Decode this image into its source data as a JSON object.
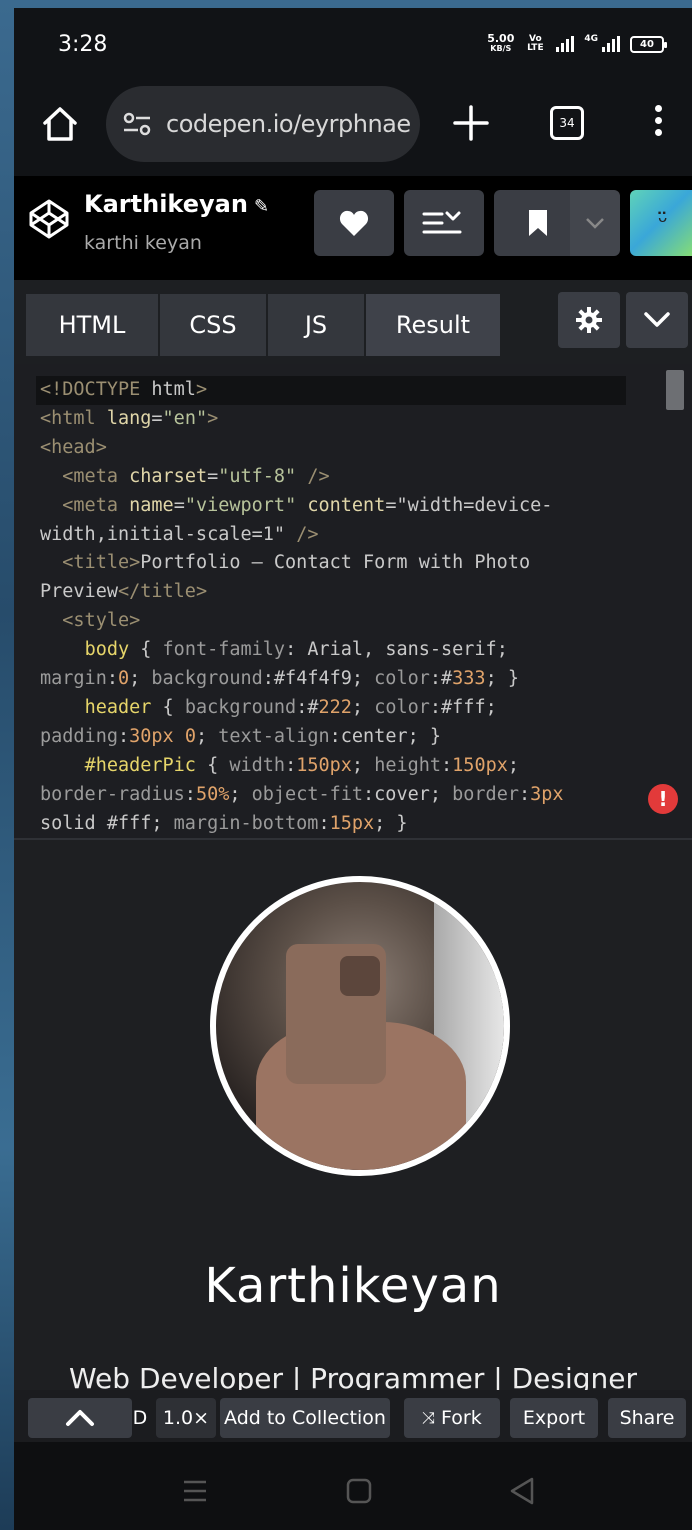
{
  "status": {
    "time": "3:28",
    "net_speed_top": "5.00",
    "net_speed_bottom": "KB/S",
    "network_label": "Vo LTE",
    "network2": "4G",
    "battery": "40"
  },
  "browser": {
    "url": "codepen.io/eyrphnae",
    "tab_count": "34"
  },
  "pen": {
    "author": "Karthikeyan",
    "username": "karthi keyan"
  },
  "tabs": [
    "HTML",
    "CSS",
    "JS",
    "Result"
  ],
  "code_lines": [
    "<!DOCTYPE html>",
    "<html lang=\"en\">",
    "<head>",
    "  <meta charset=\"utf-8\" />",
    "  <meta name=\"viewport\" content=\"width=device-",
    "width,initial-scale=1\" />",
    "  <title>Portfolio – Contact Form with Photo",
    "Preview</title>",
    "  <style>",
    "    body { font-family: Arial, sans-serif;",
    "margin:0; background:#f4f4f9; color:#333; }",
    "    header { background:#222; color:#fff;",
    "padding:30px 0; text-align:center; }",
    "    #headerPic { width:150px; height:150px;",
    "border-radius:50%; object-fit:cover; border:3px",
    "solid #fff; margin-bottom:15px; }"
  ],
  "preview": {
    "name": "Karthikeyan",
    "role": "Web Developer | Programmer | Designer"
  },
  "toolbar": {
    "details": "D",
    "zoom": "1.0×",
    "add_collection": "Add to Collection",
    "fork": "Fork",
    "export": "Export",
    "share": "Share"
  }
}
